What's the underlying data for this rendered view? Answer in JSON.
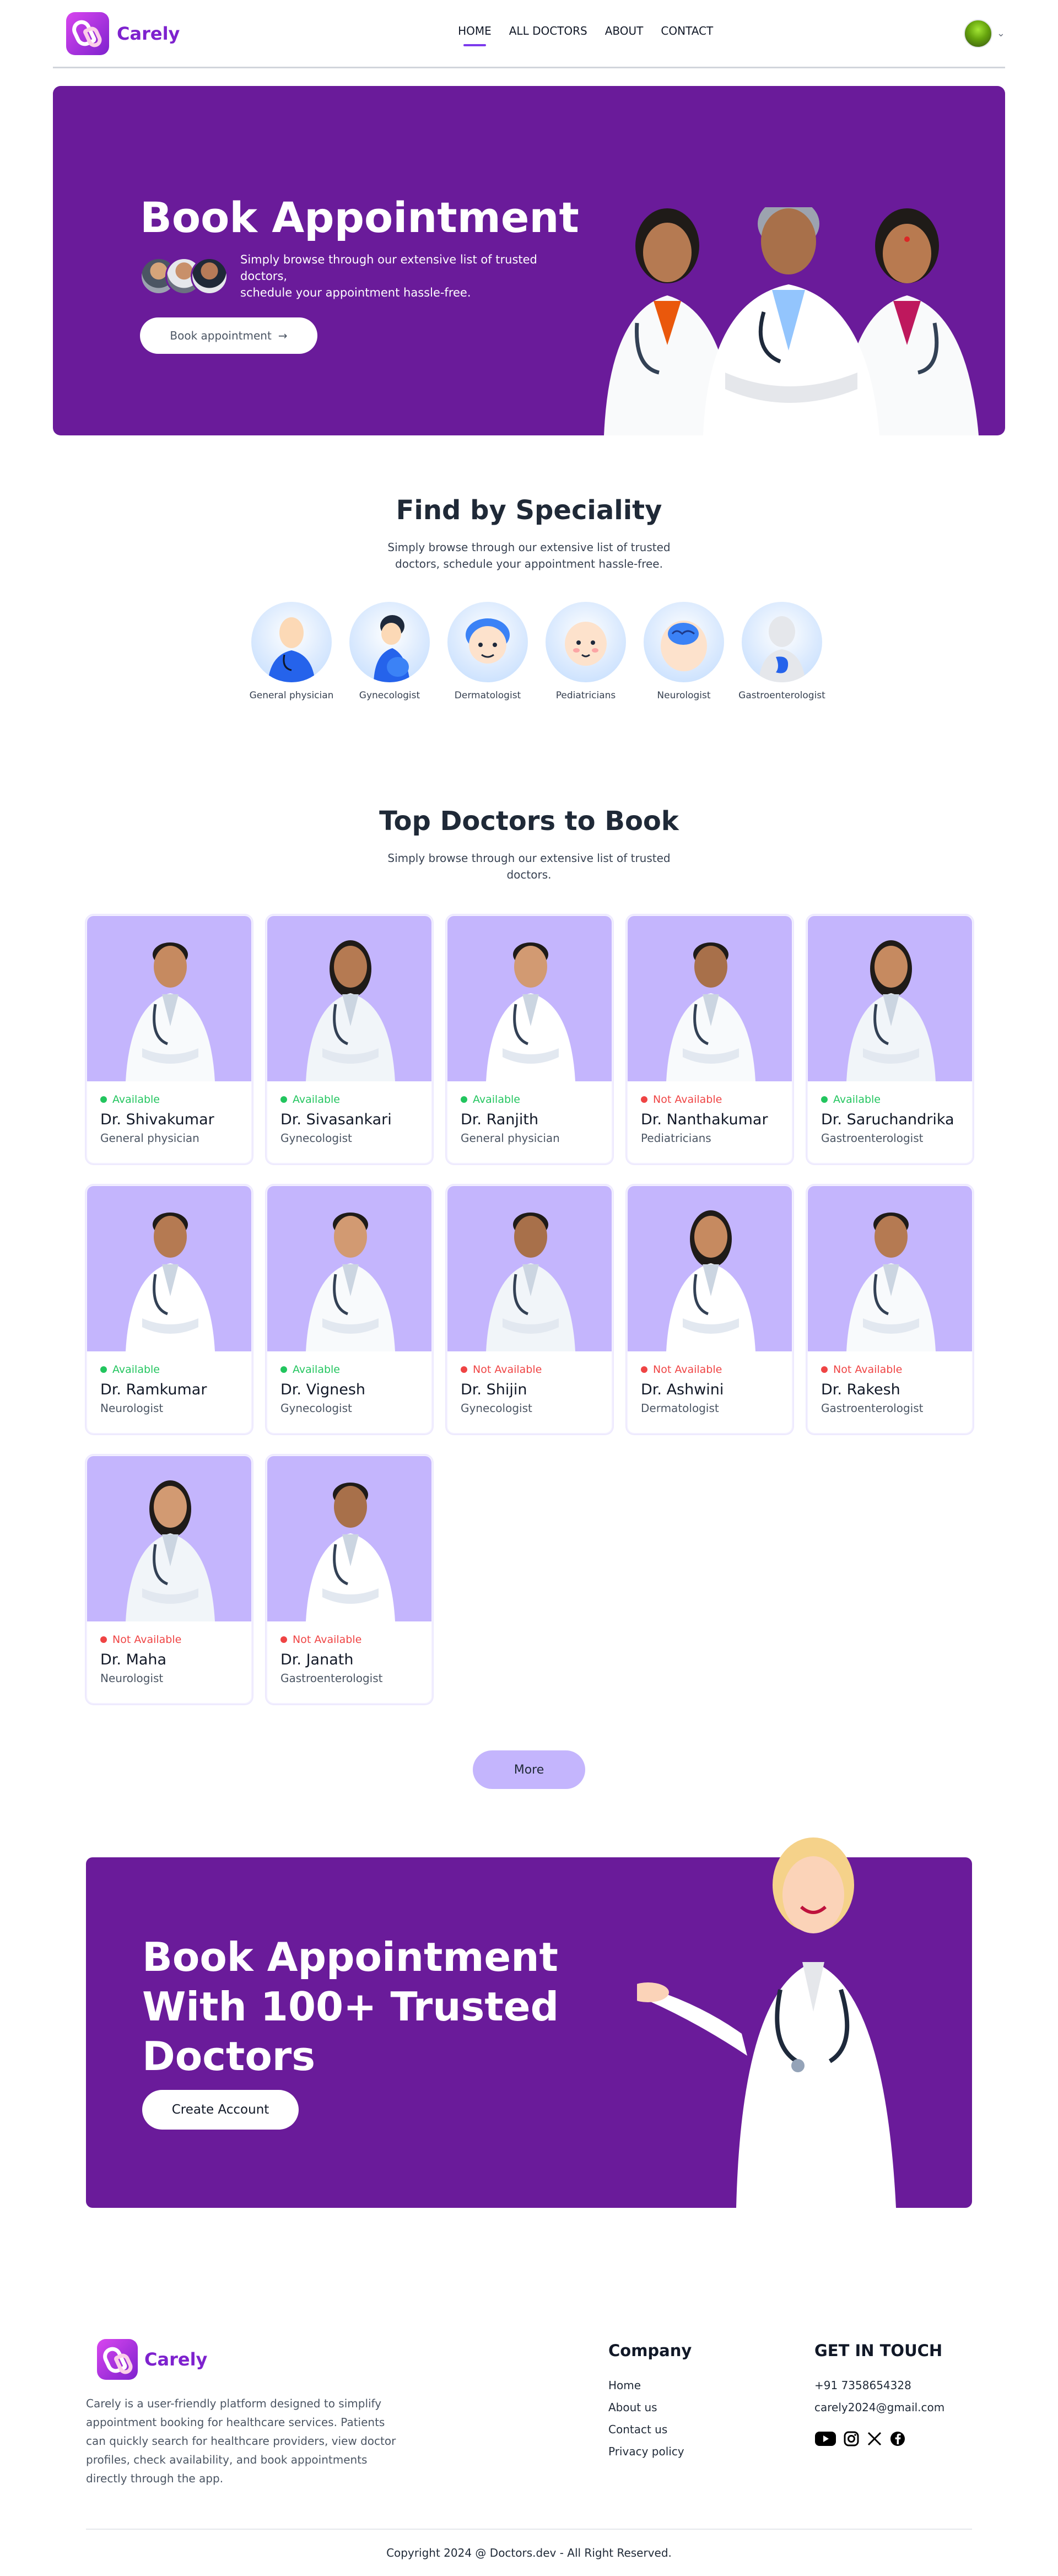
{
  "brand": {
    "name": "Carely",
    "primary_color": "#6a1b9a",
    "accent_color": "#c4b5fd"
  },
  "nav": {
    "links": [
      "HOME",
      "ALL DOCTORS",
      "ABOUT",
      "CONTACT"
    ],
    "active": "HOME"
  },
  "hero": {
    "title": "Book Appointment",
    "subtitle_line1": "Simply browse through our extensive list of trusted doctors,",
    "subtitle_line2": "schedule your appointment hassle-free.",
    "button": "Book appointment"
  },
  "speciality": {
    "title": "Find by Speciality",
    "subtitle": "Simply browse through our extensive list of trusted doctors, schedule your appointment hassle-free.",
    "items": [
      "General physician",
      "Gynecologist",
      "Dermatologist",
      "Pediatricians",
      "Neurologist",
      "Gastroenterologist"
    ]
  },
  "top_doctors": {
    "title": "Top Doctors to Book",
    "subtitle": "Simply browse through our extensive list of trusted doctors.",
    "doctors": [
      {
        "name": "Dr. Shivakumar",
        "speciality": "General physician",
        "status": "Available"
      },
      {
        "name": "Dr. Sivasankari",
        "speciality": "Gynecologist",
        "status": "Available"
      },
      {
        "name": "Dr. Ranjith",
        "speciality": "General physician",
        "status": "Available"
      },
      {
        "name": "Dr. Nanthakumar",
        "speciality": "Pediatricians",
        "status": "Not Available"
      },
      {
        "name": "Dr. Saruchandrika",
        "speciality": "Gastroenterologist",
        "status": "Available"
      },
      {
        "name": "Dr. Ramkumar",
        "speciality": "Neurologist",
        "status": "Available"
      },
      {
        "name": "Dr. Vignesh",
        "speciality": "Gynecologist",
        "status": "Available"
      },
      {
        "name": "Dr. Shijin",
        "speciality": "Gynecologist",
        "status": "Not Available"
      },
      {
        "name": "Dr. Ashwini",
        "speciality": "Dermatologist",
        "status": "Not Available"
      },
      {
        "name": "Dr. Rakesh",
        "speciality": "Gastroenterologist",
        "status": "Not Available"
      },
      {
        "name": "Dr. Maha",
        "speciality": "Neurologist",
        "status": "Not Available"
      },
      {
        "name": "Dr. Janath",
        "speciality": "Gastroenterologist",
        "status": "Not Available"
      }
    ],
    "more_button": "More"
  },
  "banner": {
    "line1": "Book Appointment",
    "line2": "With 100+ Trusted Doctors",
    "button": "Create Account"
  },
  "footer": {
    "about": "Carely is a user-friendly platform designed to simplify appointment booking for healthcare services. Patients can quickly search for healthcare providers, view doctor profiles, check availability, and book appointments directly through the app.",
    "company_title": "Company",
    "company_links": [
      "Home",
      "About us",
      "Contact us",
      "Privacy policy"
    ],
    "contact_title": "GET IN TOUCH",
    "phone": "+91 7358654328",
    "email": "carely2024@gmail.com",
    "socials": [
      "youtube-icon",
      "instagram-icon",
      "x-icon",
      "facebook-icon"
    ],
    "copyright": "Copyright 2024 @ Doctors.dev - All Right Reserved."
  }
}
